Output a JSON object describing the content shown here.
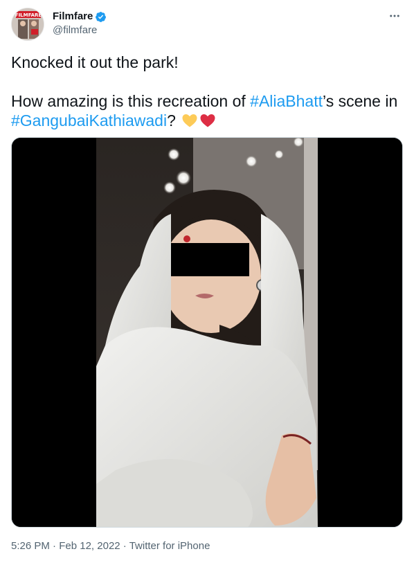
{
  "author": {
    "display_name": "Filmfare",
    "handle": "@filmfare",
    "avatar_logo_text": "FILMFARE",
    "verified_icon": "verified-badge-icon"
  },
  "more_icon": "more-horizontal-icon",
  "tweet": {
    "line1": "Knocked it out the park!",
    "line2_prefix": "How amazing is this recreation of ",
    "hashtag1": "#AliaBhatt",
    "line2_mid": "’s scene in",
    "hashtag2": "#GangubaiKathiawadi",
    "line3_suffix": "?",
    "emojis": [
      "yellow-heart-emoji",
      "red-heart-emoji"
    ]
  },
  "media": {
    "description_icon": "video-thumbnail"
  },
  "meta": {
    "time": "5:26 PM",
    "separator": "·",
    "date": "Feb 12, 2022",
    "source": "Twitter for iPhone"
  },
  "colors": {
    "link": "#1d9bf0",
    "secondary_text": "#536471",
    "verified": "#1d9bf0"
  }
}
